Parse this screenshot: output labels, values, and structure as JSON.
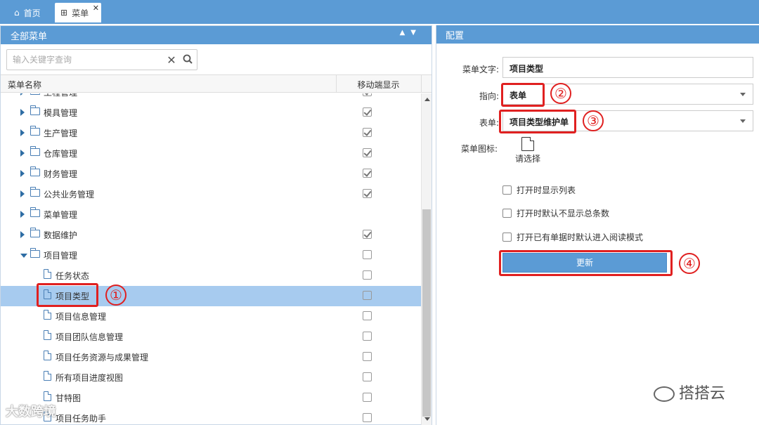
{
  "tabs": {
    "home": "首页",
    "menu": "菜单",
    "close": "✕"
  },
  "left_panel": {
    "title": "全部菜单",
    "search_placeholder": "输入关键字查询",
    "col_name": "菜单名称",
    "col_mobile": "移动端显示",
    "partial_top_row": "工程管理",
    "rows": [
      {
        "label": "模具管理",
        "type": "folder",
        "checked": true
      },
      {
        "label": "生产管理",
        "type": "folder",
        "checked": true
      },
      {
        "label": "仓库管理",
        "type": "folder",
        "checked": true
      },
      {
        "label": "财务管理",
        "type": "folder",
        "checked": true
      },
      {
        "label": "公共业务管理",
        "type": "folder",
        "checked": true
      },
      {
        "label": "菜单管理",
        "type": "folder",
        "checked": false,
        "nocheck": true
      },
      {
        "label": "数据维护",
        "type": "folder",
        "checked": true
      },
      {
        "label": "项目管理",
        "type": "folder-open",
        "checked": false
      },
      {
        "label": "任务状态",
        "type": "file",
        "checked": false
      },
      {
        "label": "项目类型",
        "type": "file",
        "checked": false,
        "selected": true
      },
      {
        "label": "项目信息管理",
        "type": "file",
        "checked": false
      },
      {
        "label": "项目团队信息管理",
        "type": "file",
        "checked": false
      },
      {
        "label": "项目任务资源与成果管理",
        "type": "file",
        "checked": false
      },
      {
        "label": "所有项目进度视图",
        "type": "file",
        "checked": false
      },
      {
        "label": "甘特图",
        "type": "file",
        "checked": false
      },
      {
        "label": "项目任务助手",
        "type": "file",
        "checked": false
      }
    ]
  },
  "right_panel": {
    "title": "配置",
    "menu_text_label": "菜单文字:",
    "menu_text_value": "项目类型",
    "point_label": "指向:",
    "point_value": "表单",
    "form_label": "表单:",
    "form_value": "项目类型维护单",
    "icon_label": "菜单图标:",
    "icon_pick": "请选择",
    "options": [
      "打开时显示列表",
      "打开时默认不显示总条数",
      "打开已有单据时默认进入阅读模式"
    ],
    "update_button": "更新"
  },
  "annotations": [
    "①",
    "②",
    "③",
    "④"
  ],
  "watermarks": {
    "left": "大数跨境",
    "right": "搭搭云"
  },
  "colors": {
    "header_blue": "#5b9bd5",
    "selected_row": "#a7cbef",
    "annotation_red": "#e02020"
  }
}
